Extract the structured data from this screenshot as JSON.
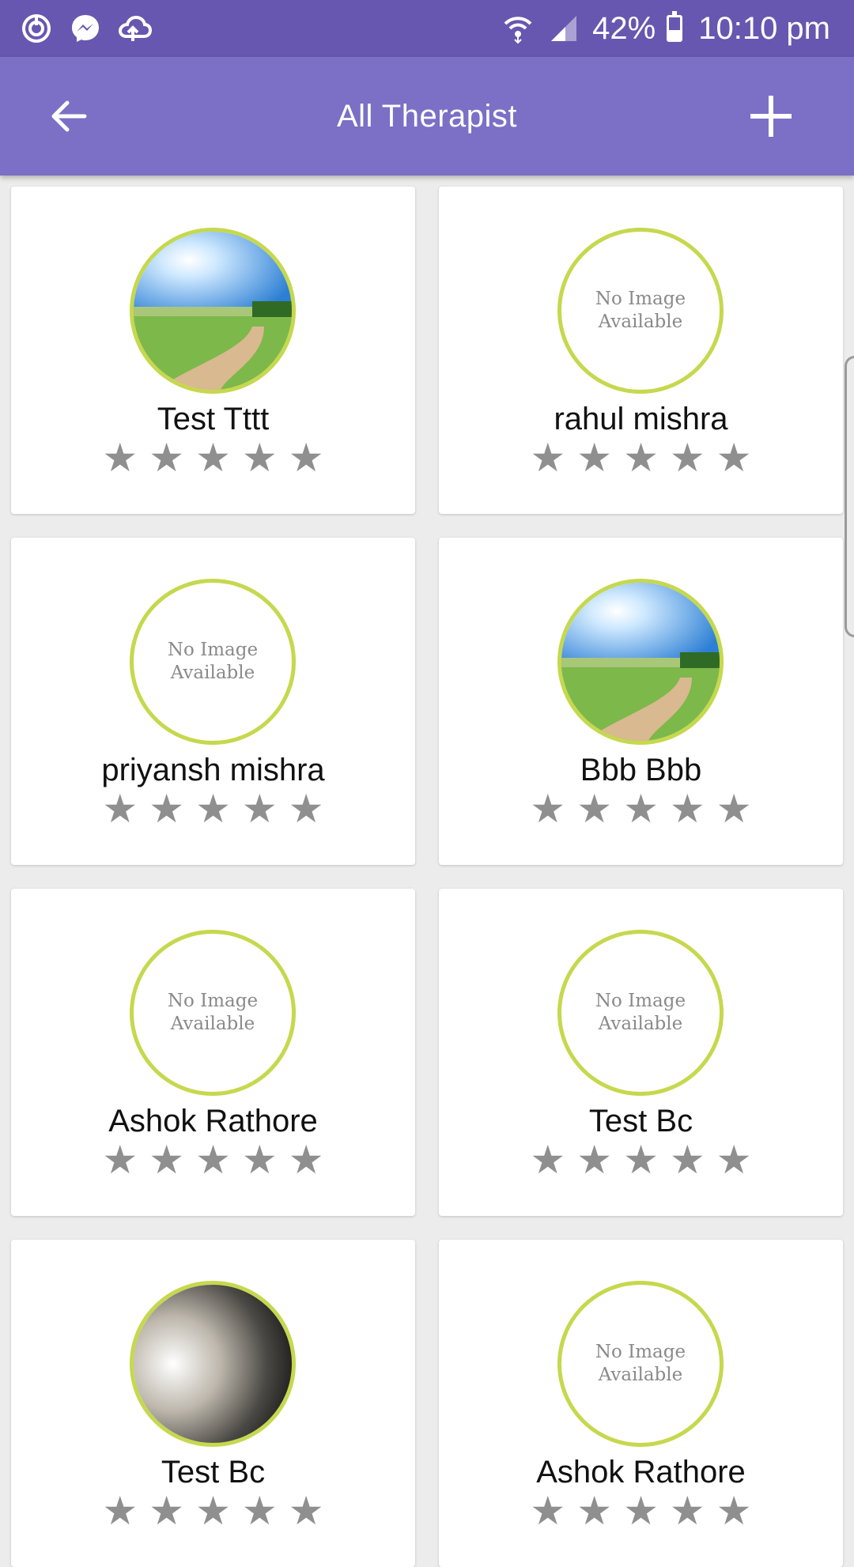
{
  "status_bar": {
    "battery_percent": "42%",
    "battery_level": 0.42,
    "time": "10:10 pm",
    "icons": [
      "power-sync-icon",
      "messenger-icon",
      "cloud-upload-icon",
      "wifi-icon",
      "signal-icon",
      "battery-icon"
    ]
  },
  "app_bar": {
    "title": "All Therapist",
    "back_icon": "arrow-left-icon",
    "add_icon": "plus-icon"
  },
  "colors": {
    "status_bar": "#6757b0",
    "app_bar": "#7b6fc6",
    "avatar_ring": "#c6d84d",
    "star": "#8f8f8f"
  },
  "therapists": [
    {
      "name": "Test Tttt",
      "photo": "landscape",
      "placeholder": "",
      "rating": 0
    },
    {
      "name": "rahul mishra",
      "photo": "none",
      "placeholder": "No Image Available",
      "rating": 0
    },
    {
      "name": "priyansh mishra",
      "photo": "none",
      "placeholder": "No Image Available",
      "rating": 0
    },
    {
      "name": "Bbb Bbb",
      "photo": "landscape",
      "placeholder": "",
      "rating": 0
    },
    {
      "name": "Ashok Rathore",
      "photo": "none",
      "placeholder": "No Image Available",
      "rating": 0
    },
    {
      "name": "Test Bc",
      "photo": "none",
      "placeholder": "No Image Available",
      "rating": 0
    },
    {
      "name": "Test Bc",
      "photo": "moon",
      "placeholder": "",
      "rating": 0
    },
    {
      "name": "Ashok Rathore",
      "photo": "none",
      "placeholder": "No Image Available",
      "rating": 0
    }
  ],
  "star_glyph": "★"
}
